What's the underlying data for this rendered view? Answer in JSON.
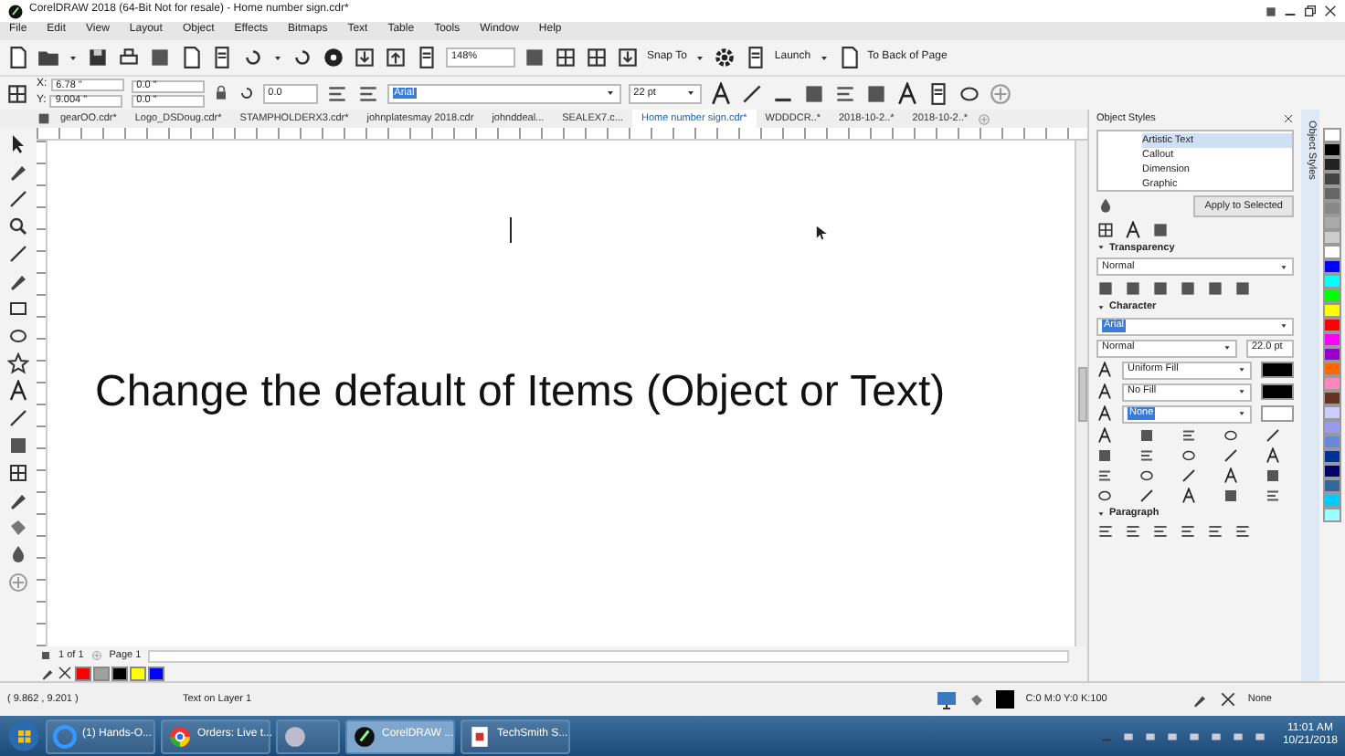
{
  "window": {
    "title": "CorelDRAW 2018 (64-Bit Not for resale) - Home number sign.cdr*"
  },
  "menu": [
    "File",
    "Edit",
    "View",
    "Layout",
    "Object",
    "Effects",
    "Bitmaps",
    "Text",
    "Table",
    "Tools",
    "Window",
    "Help"
  ],
  "toolbar": {
    "zoom": "148%",
    "snap": "Snap To",
    "launch": "Launch",
    "back": "To Back of Page"
  },
  "property_bar": {
    "x_label": "X:",
    "x": "6.78 \"",
    "y_label": "Y:",
    "y": "9.004 \"",
    "width": "0.0 \"",
    "height": "0.0 \"",
    "angle": "0.0",
    "font": "Arial",
    "size": "22 pt"
  },
  "doc_tabs": [
    {
      "label": "gearOO.cdr*",
      "selected": false
    },
    {
      "label": "Logo_DSDoug.cdr*",
      "selected": false
    },
    {
      "label": "STAMPHOLDERX3.cdr*",
      "selected": false
    },
    {
      "label": "johnplatesmay 2018.cdr",
      "selected": false
    },
    {
      "label": "johnddeal...",
      "selected": false
    },
    {
      "label": "SEALEX7.c...",
      "selected": false
    },
    {
      "label": "Home number sign.cdr*",
      "selected": true
    },
    {
      "label": "WDDDCR..*",
      "selected": false
    },
    {
      "label": "2018-10-2..*",
      "selected": false
    },
    {
      "label": "2018-10-2..*",
      "selected": false
    }
  ],
  "canvas": {
    "text": "Change the default of Items (Object or Text)"
  },
  "page_nav": {
    "count": "1 of 1",
    "page_tab": "Page 1"
  },
  "swatches": [
    {
      "color": "#ff0000"
    },
    {
      "color": "#a0a0a0"
    },
    {
      "color": "#000000"
    },
    {
      "color": "#ffff00"
    },
    {
      "color": "#0000ff"
    }
  ],
  "docker": {
    "title": "Object Styles",
    "side_tab": "Object Styles",
    "styles": [
      {
        "label": "Artistic Text",
        "selected": true
      },
      {
        "label": "Callout",
        "selected": false
      },
      {
        "label": "Dimension",
        "selected": false
      },
      {
        "label": "Graphic",
        "selected": false
      }
    ],
    "apply": "Apply to Selected",
    "transparency": {
      "title": "Transparency",
      "mode": "Normal"
    },
    "character": {
      "title": "Character",
      "font": "Arial",
      "style": "Normal",
      "size": "22.0 pt",
      "fill": "Uniform Fill",
      "background": "No Fill",
      "outline": "None"
    },
    "paragraph": {
      "title": "Paragraph"
    }
  },
  "palette": [
    {
      "color": "#ffffff"
    },
    {
      "color": "#000000"
    },
    {
      "color": "#222222"
    },
    {
      "color": "#444444"
    },
    {
      "color": "#666666"
    },
    {
      "color": "#888888"
    },
    {
      "color": "#aaaaaa"
    },
    {
      "color": "#cccccc"
    },
    {
      "color": "#ffffff"
    },
    {
      "color": "#0000ff"
    },
    {
      "color": "#00ffff"
    },
    {
      "color": "#00ff00"
    },
    {
      "color": "#ffff00"
    },
    {
      "color": "#ff0000"
    },
    {
      "color": "#ff00ff"
    },
    {
      "color": "#9900cc"
    },
    {
      "color": "#ff6600"
    },
    {
      "color": "#ff88bb"
    },
    {
      "color": "#663322"
    },
    {
      "color": "#ccccff"
    },
    {
      "color": "#9999ee"
    },
    {
      "color": "#6688dd"
    },
    {
      "color": "#003399"
    },
    {
      "color": "#000066"
    },
    {
      "color": "#336699"
    },
    {
      "color": "#00ccff"
    },
    {
      "color": "#99ffff"
    }
  ],
  "status_bar": {
    "coords": "( 9.862 , 9.201 )",
    "layer": "Text on Layer 1",
    "fill": "C:0 M:0 Y:0 K:100",
    "outline": "None"
  },
  "taskbar": {
    "items": [
      {
        "label": "(1) Hands-O...",
        "selected": false
      },
      {
        "label": "Orders: Live t...",
        "selected": false
      },
      {
        "selected": false
      },
      {
        "label": "CorelDRAW ...",
        "selected": true
      },
      {
        "label": "TechSmith S...",
        "selected": false
      }
    ],
    "time": "11:01 AM",
    "date": "10/21/2018"
  }
}
